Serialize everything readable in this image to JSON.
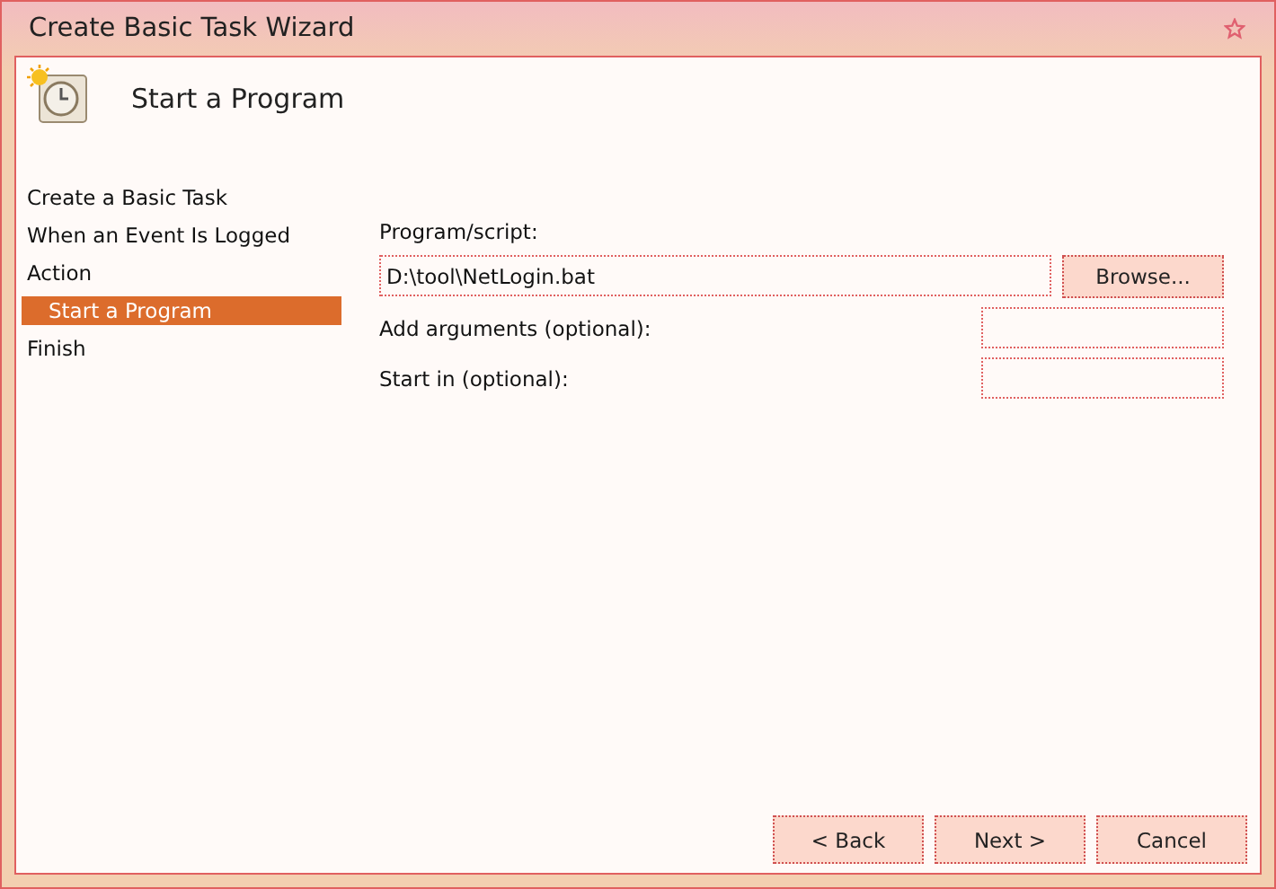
{
  "window": {
    "title": "Create Basic Task Wizard"
  },
  "header": {
    "title": "Start a Program"
  },
  "steps": [
    {
      "label": "Create a Basic Task",
      "selected": false
    },
    {
      "label": "When an Event Is Logged",
      "selected": false
    },
    {
      "label": "Action",
      "selected": false,
      "children": [
        {
          "label": "Start a Program",
          "selected": true
        }
      ]
    },
    {
      "label": "Finish",
      "selected": false
    }
  ],
  "form": {
    "program_label": "Program/script:",
    "program_value": "D:\\tool\\NetLogin.bat",
    "browse": "Browse...",
    "arguments_label": "Add arguments (optional):",
    "start_in_label": "Start in (optional):"
  },
  "buttons": [
    {
      "label": "< Back"
    },
    {
      "label": "Next >"
    },
    {
      "label": "Cancel"
    }
  ]
}
